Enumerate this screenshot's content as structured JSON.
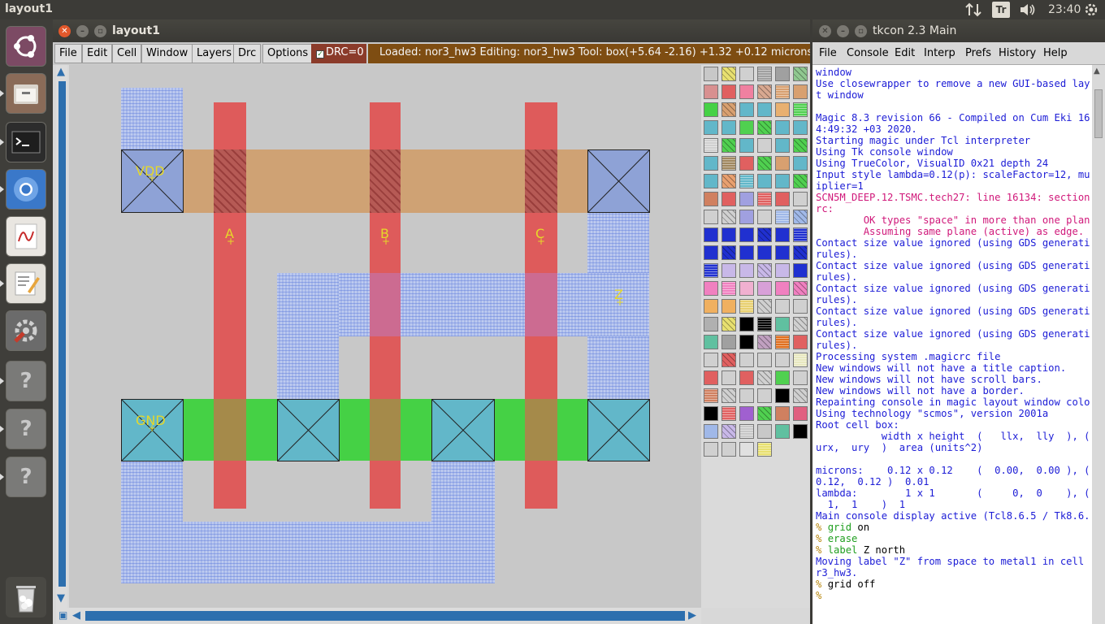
{
  "topbar": {
    "app_title": "layout1",
    "input_indicator": "Tr",
    "clock": "23:40"
  },
  "launcher": {
    "items": [
      {
        "name": "ubuntu-dash-icon"
      },
      {
        "name": "files-icon"
      },
      {
        "name": "terminal-icon"
      },
      {
        "name": "chromium-icon"
      },
      {
        "name": "pdf-viewer-icon"
      },
      {
        "name": "text-editor-icon"
      },
      {
        "name": "system-settings-icon"
      },
      {
        "name": "unknown-app-icon",
        "glyph": "?"
      },
      {
        "name": "unknown-app-icon",
        "glyph": "?"
      },
      {
        "name": "unknown-app-icon",
        "glyph": "?"
      },
      {
        "name": "trash-icon"
      }
    ]
  },
  "magic_window": {
    "title": "layout1",
    "menu": [
      "File",
      "Edit",
      "Cell",
      "Window",
      "Layers",
      "Drc",
      "Options"
    ],
    "drc": "DRC=0",
    "status": "Loaded: nor3_hw3 Editing: nor3_hw3 Tool: box",
    "coords": "(+5.64 -2.16) +1.32 +0.12 microns",
    "labels": {
      "vdd": "VDD",
      "gnd": "GND",
      "a": "A",
      "b": "B",
      "c": "C",
      "z": "Z"
    }
  },
  "tkcon": {
    "title": "tkcon 2.3 Main",
    "menu": [
      "File",
      "Console",
      "Edit",
      "Interp",
      "Prefs",
      "History",
      "Help"
    ],
    "lines": [
      {
        "t": "window",
        "c": "#1c1cd6"
      },
      {
        "t": "Use closewrapper to remove a new GUI-based layou",
        "c": "#1c1cd6"
      },
      {
        "t": "t window",
        "c": "#1c1cd6"
      },
      {
        "t": "",
        "c": "#1c1cd6"
      },
      {
        "t": "Magic 8.3 revision 66 - Compiled on Cum Eki 16 0",
        "c": "#1c1cd6"
      },
      {
        "t": "4:49:32 +03 2020.",
        "c": "#1c1cd6"
      },
      {
        "t": "Starting magic under Tcl interpreter",
        "c": "#1c1cd6"
      },
      {
        "t": "Using Tk console window",
        "c": "#1c1cd6"
      },
      {
        "t": "Using TrueColor, VisualID 0x21 depth 24",
        "c": "#1c1cd6"
      },
      {
        "t": "Input style lambda=0.12(p): scaleFactor=12, mult",
        "c": "#1c1cd6"
      },
      {
        "t": "iplier=1",
        "c": "#1c1cd6"
      },
      {
        "t": "SCN5M_DEEP.12.TSMC.tech27: line 16134: section d",
        "c": "#d0187a"
      },
      {
        "t": "rc:",
        "c": "#d0187a"
      },
      {
        "t": "        OK types \"space\" in more than one plane.",
        "c": "#d0187a"
      },
      {
        "t": "        Assuming same plane (active) as edge.",
        "c": "#d0187a"
      },
      {
        "t": "Contact size value ignored (using GDS generation",
        "c": "#1c1cd6"
      },
      {
        "t": "rules).",
        "c": "#1c1cd6"
      },
      {
        "t": "Contact size value ignored (using GDS generation",
        "c": "#1c1cd6"
      },
      {
        "t": "rules).",
        "c": "#1c1cd6"
      },
      {
        "t": "Contact size value ignored (using GDS generation",
        "c": "#1c1cd6"
      },
      {
        "t": "rules).",
        "c": "#1c1cd6"
      },
      {
        "t": "Contact size value ignored (using GDS generation",
        "c": "#1c1cd6"
      },
      {
        "t": "rules).",
        "c": "#1c1cd6"
      },
      {
        "t": "Contact size value ignored (using GDS generation",
        "c": "#1c1cd6"
      },
      {
        "t": "rules).",
        "c": "#1c1cd6"
      },
      {
        "t": "Processing system .magicrc file",
        "c": "#1c1cd6"
      },
      {
        "t": "New windows will not have a title caption.",
        "c": "#1c1cd6"
      },
      {
        "t": "New windows will not have scroll bars.",
        "c": "#1c1cd6"
      },
      {
        "t": "New windows will not have a border.",
        "c": "#1c1cd6"
      },
      {
        "t": "Repainting console in magic layout window colors",
        "c": "#1c1cd6"
      },
      {
        "t": "Using technology \"scmos\", version 2001a",
        "c": "#1c1cd6"
      },
      {
        "t": "Root cell box:",
        "c": "#1c1cd6"
      },
      {
        "t": "           width x height  (   llx,  lly  ), (",
        "c": "#1c1cd6"
      },
      {
        "t": "urx,  ury  )  area (units^2)",
        "c": "#1c1cd6"
      },
      {
        "t": "",
        "c": "#1c1cd6"
      },
      {
        "t": "microns:    0.12 x 0.12    (  0.00,  0.00 ), (",
        "c": "#1c1cd6"
      },
      {
        "t": "0.12,  0.12 )  0.01",
        "c": "#1c1cd6"
      },
      {
        "t": "lambda:        1 x 1       (     0,  0    ), (",
        "c": "#1c1cd6"
      },
      {
        "t": "  1,  1    )  1",
        "c": "#1c1cd6"
      },
      {
        "t": "Main console display active (Tcl8.6.5 / Tk8.6.5)",
        "c": "#1c1cd6"
      }
    ],
    "commands": [
      {
        "prompt": "% ",
        "cmd": "grid",
        "arg": " on"
      },
      {
        "prompt": "% ",
        "cmd": "erase",
        "arg": ""
      },
      {
        "prompt": "% ",
        "cmd": "label",
        "arg": " Z north"
      }
    ],
    "msg": [
      "Moving label \"Z\" from space to metal1 in cell no",
      "r3_hw3."
    ],
    "last": {
      "prompt": "% ",
      "cmd": "grid off"
    },
    "cursor_prompt": "%"
  }
}
